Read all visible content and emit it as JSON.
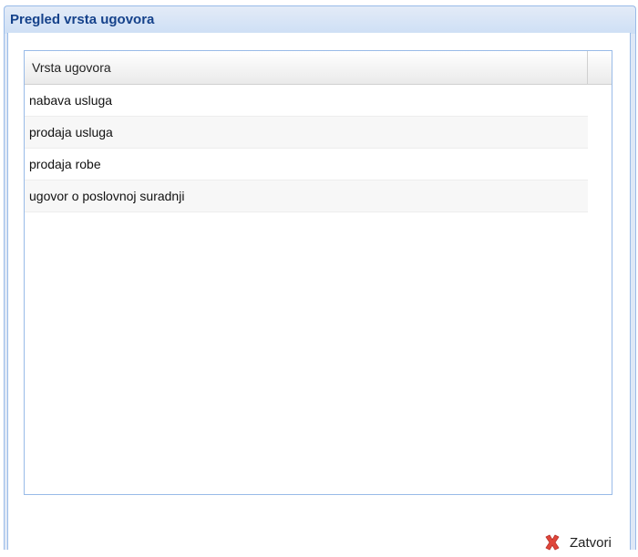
{
  "window": {
    "title": "Pregled vrsta ugovora"
  },
  "grid": {
    "column_header": "Vrsta ugovora",
    "rows": [
      "nabava usluga",
      "prodaja usluga",
      "prodaja robe",
      "ugovor o poslovnoj suradnji"
    ]
  },
  "footer": {
    "close_label": "Zatvori",
    "close_icon": "close-icon",
    "close_icon_color": "#e0463a"
  }
}
